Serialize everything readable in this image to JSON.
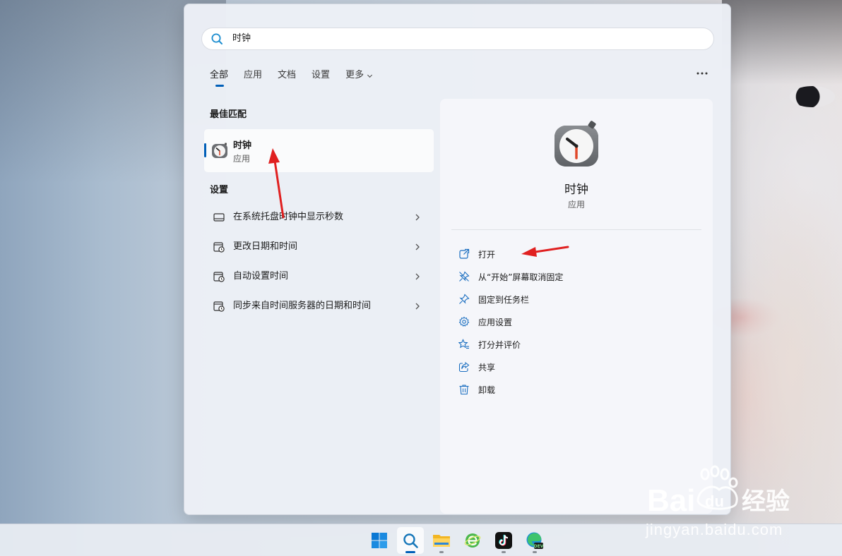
{
  "search": {
    "query": "时钟"
  },
  "tabs": [
    {
      "label": "全部",
      "active": true
    },
    {
      "label": "应用",
      "active": false
    },
    {
      "label": "文档",
      "active": false
    },
    {
      "label": "设置",
      "active": false
    },
    {
      "label": "更多",
      "active": false,
      "has_dropdown": true
    }
  ],
  "more_menu_icon": "more-horizontal-icon",
  "best_match": {
    "section_title": "最佳匹配",
    "name": "时钟",
    "type": "应用",
    "icon": "clock-app-icon"
  },
  "settings_section": {
    "title": "设置",
    "items": [
      {
        "label": "在系统托盘时钟中显示秒数",
        "icon": "taskbar-icon"
      },
      {
        "label": "更改日期和时间",
        "icon": "date-time-icon"
      },
      {
        "label": "自动设置时间",
        "icon": "date-time-icon"
      },
      {
        "label": "同步来自时间服务器的日期和时间",
        "icon": "date-time-icon"
      }
    ]
  },
  "detail": {
    "name": "时钟",
    "type": "应用",
    "actions": [
      {
        "label": "打开",
        "icon": "open-external-icon"
      },
      {
        "label": "从“开始”屏幕取消固定",
        "icon": "unpin-icon"
      },
      {
        "label": "固定到任务栏",
        "icon": "pin-icon"
      },
      {
        "label": "应用设置",
        "icon": "gear-icon"
      },
      {
        "label": "打分并评价",
        "icon": "star-rate-icon"
      },
      {
        "label": "共享",
        "icon": "share-icon"
      },
      {
        "label": "卸载",
        "icon": "trash-icon"
      }
    ]
  },
  "taskbar": [
    {
      "icon": "windows-start-icon",
      "active": false,
      "running": false
    },
    {
      "icon": "search-icon",
      "active": true,
      "running": true
    },
    {
      "icon": "file-explorer-icon",
      "active": false,
      "running": true
    },
    {
      "icon": "browser-e-icon",
      "active": false,
      "running": false
    },
    {
      "icon": "tiktok-icon",
      "active": false,
      "running": true
    },
    {
      "icon": "edge-dev-icon",
      "active": false,
      "running": true
    }
  ],
  "watermark": {
    "logo": "Baidu经验",
    "url": "jingyan.baidu.com"
  },
  "colors": {
    "accent": "#005fb8",
    "annotation": "#e02020"
  }
}
